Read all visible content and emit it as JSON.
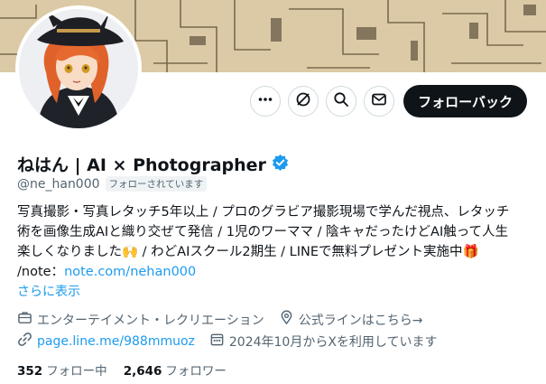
{
  "profile": {
    "display_name": "ねはん | AI × Photographer",
    "handle": "@ne_han000",
    "follows_you_badge": "フォローされています",
    "follow_button_label": "フォローバック",
    "bio_lines": [
      "写真撮影・写真レタッチ5年以上 / プロのグラビア撮影現場で学んだ視点、レタッチ",
      "術を画像生成AIと織り交ぜて発信 / 1児のワーママ / 陰キャだったけどAI触って人生",
      "楽しくなりました🙌 / わどAIスクール2期生 / LINEで無料プレゼント実施中🎁"
    ],
    "note_prefix": "/note：",
    "note_link": "note.com/nehan000",
    "show_more": "さらに表示",
    "category": "エンターテイメント・レクリエーション",
    "location": "公式ラインはこちら→",
    "website": "page.line.me/988mmuoz",
    "joined": "2024年10月からXを利用しています",
    "following_count": "352",
    "following_label": "フォロー中",
    "followers_count": "2,646",
    "followers_label": "フォロワー"
  },
  "icons": {
    "more": "more-icon",
    "grok": "grok-icon",
    "search": "search-icon",
    "message": "message-icon",
    "verified": "verified-badge-icon",
    "category": "briefcase-icon",
    "location": "location-pin-icon",
    "website": "link-icon",
    "joined": "calendar-icon"
  },
  "colors": {
    "accent": "#1d9bf0",
    "button_dark": "#0f1419",
    "muted": "#536471"
  }
}
